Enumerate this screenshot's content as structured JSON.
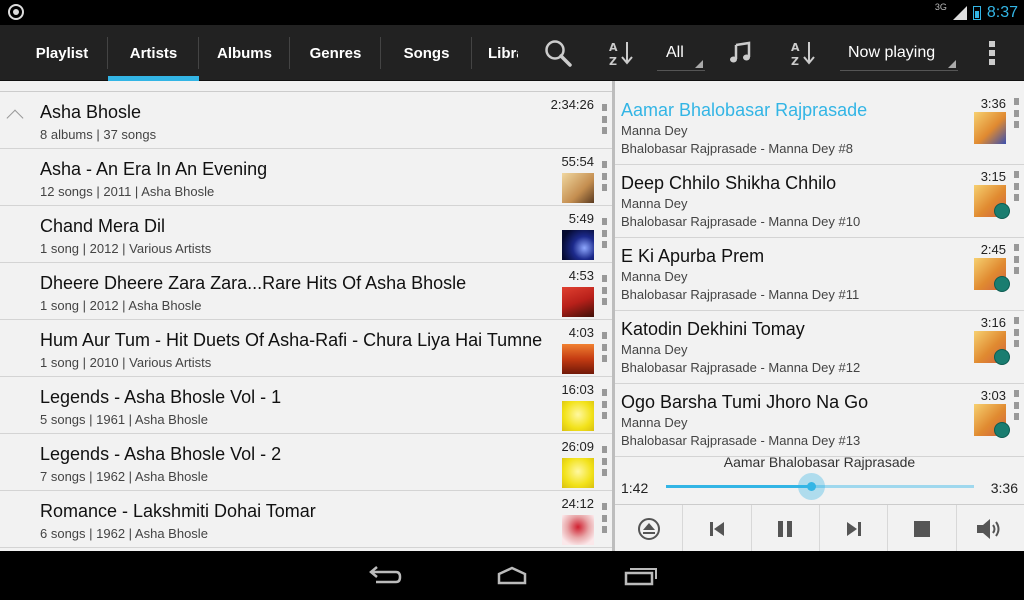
{
  "status": {
    "network": "3G",
    "time": "8:37"
  },
  "tabs": [
    "Playlist",
    "Artists",
    "Albums",
    "Genres",
    "Songs",
    "Libra"
  ],
  "left_filter": "All",
  "right_view": "Now playing",
  "left": {
    "group": {
      "title": "Asha Bhosle",
      "sub": "8 albums | 37 songs",
      "duration": "2:34:26"
    },
    "albums": [
      {
        "title": "Asha - An Era In An Evening",
        "sub": "12 songs | 2011 | Asha Bhosle",
        "duration": "55:54",
        "art": "#c48e50"
      },
      {
        "title": "Chand Mera Dil",
        "sub": "1 song | 2012 | Various Artists",
        "duration": "5:49",
        "art": "#1c2a8c"
      },
      {
        "title": "Dheere Dheere Zara Zara...Rare Hits Of Asha Bhosle",
        "sub": "1 song | 2012 | Asha Bhosle",
        "duration": "4:53",
        "art": "#b8201a"
      },
      {
        "title": "Hum Aur Tum - Hit Duets Of Asha-Rafi - Chura Liya Hai Tumne",
        "sub": "1 song | 2010 | Various Artists",
        "duration": "4:03",
        "art": "#c43b12"
      },
      {
        "title": "Legends - Asha Bhosle Vol - 1",
        "sub": "5 songs | 1961 | Asha Bhosle",
        "duration": "16:03",
        "art": "#f2e21a"
      },
      {
        "title": "Legends - Asha Bhosle Vol - 2",
        "sub": "7 songs | 1962 | Asha Bhosle",
        "duration": "26:09",
        "art": "#f2e21a"
      },
      {
        "title": "Romance - Lakshmiti Dohai Tomar",
        "sub": "6 songs | 1962 | Asha Bhosle",
        "duration": "24:12",
        "art": "#e8a6a8"
      }
    ]
  },
  "queue": [
    {
      "title": "Aamar Bhalobasar Rajprasade",
      "artist": "Manna Dey",
      "album": "Bhalobasar Rajprasade - Manna Dey #8",
      "duration": "3:36"
    },
    {
      "title": "Deep Chhilo Shikha Chhilo",
      "artist": "Manna Dey",
      "album": "Bhalobasar Rajprasade - Manna Dey #10",
      "duration": "3:15"
    },
    {
      "title": "E Ki Apurba Prem",
      "artist": "Manna Dey",
      "album": "Bhalobasar Rajprasade - Manna Dey #11",
      "duration": "2:45"
    },
    {
      "title": "Katodin Dekhini Tomay",
      "artist": "Manna Dey",
      "album": "Bhalobasar Rajprasade - Manna Dey #12",
      "duration": "3:16"
    },
    {
      "title": "Ogo Barsha Tumi Jhoro Na Go",
      "artist": "Manna Dey",
      "album": "Bhalobasar Rajprasade - Manna Dey #13",
      "duration": "3:03"
    }
  ],
  "player": {
    "now_title": "Aamar Bhalobasar Rajprasade",
    "elapsed": "1:42",
    "total": "3:36",
    "progress": 0.47
  },
  "colors": {
    "accent": "#33b5e5",
    "bar": "#222222",
    "panel": "#f2f2f2"
  }
}
